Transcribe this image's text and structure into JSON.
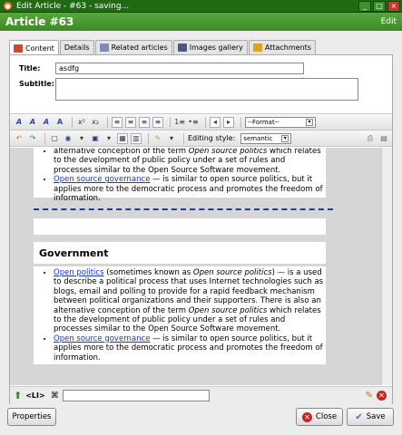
{
  "window": {
    "title": "Edit Article - #63 - saving..."
  },
  "header": {
    "title": "Article #63",
    "edit_label": "Edit"
  },
  "tabs": [
    {
      "label": "Content",
      "active": true
    },
    {
      "label": "Details"
    },
    {
      "label": "Related articles"
    },
    {
      "label": "Images gallery"
    },
    {
      "label": "Attachments"
    }
  ],
  "form": {
    "title_label": "Title:",
    "title_value": "asdfg",
    "subtitle_label": "Subtitle:"
  },
  "toolbar": {
    "format_select": "--Format--",
    "editing_style_label": "Editing style:",
    "editing_style_value": "semantic"
  },
  "content": {
    "top_items": [
      {
        "before": "alternative conception of the term ",
        "em": "Open source politics",
        "after": " which relates to the development of public policy under a set of rules and processes similar to the Open Source Software movement."
      },
      {
        "link": "Open source governance",
        "text": " — is similar to open source politics, but it applies more to the democratic process and promotes the freedom of information."
      }
    ],
    "heading": "Government",
    "items": [
      {
        "link": "Open politics",
        "text1": " (sometimes known as ",
        "em": "Open source politics",
        "text2": ") — is a used to describe a political process that uses Internet technologies such as blogs, email and polling to provide for a rapid feedback mechanism between political organizations and their supporters. There is also an alternative conception of the term ",
        "em2": "Open source politics",
        "text3": " which relates to the development of public policy under a set of rules and processes similar to the Open Source Software movement."
      },
      {
        "link": "Open source governance",
        "text": " — is similar to open source politics, but it applies more to the democratic process and promotes the freedom of information."
      }
    ]
  },
  "status": {
    "path_tag": "<LI>"
  },
  "buttons": {
    "properties": "Properties",
    "close": "Close",
    "save": "Save"
  },
  "colors": {
    "titlebar": "#1f6a12",
    "header": "#4a9a30",
    "link": "#1a34c6",
    "dash": "#1c3aa8"
  }
}
